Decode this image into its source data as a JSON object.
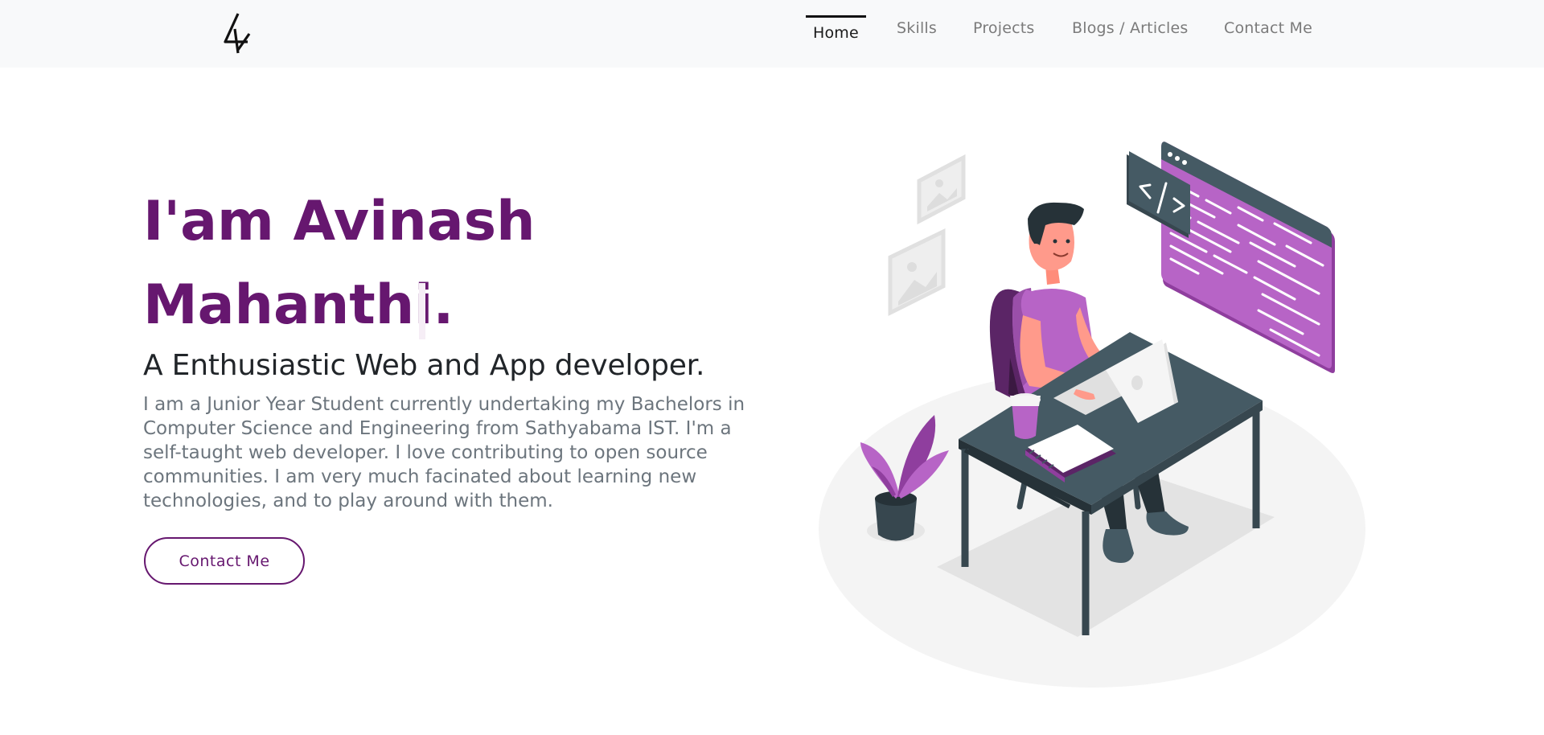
{
  "colors": {
    "accent": "#66176f",
    "illustration_purple": "#b764c6",
    "desk_dark": "#455a64",
    "nav_bg": "#f8f9fa"
  },
  "nav": {
    "logo_icon": "logo-mark-icon",
    "items": [
      {
        "label": "Home",
        "active": true
      },
      {
        "label": "Skills",
        "active": false
      },
      {
        "label": "Projects",
        "active": false
      },
      {
        "label": "Blogs / Articles",
        "active": false
      },
      {
        "label": "Contact Me",
        "active": false
      }
    ]
  },
  "hero": {
    "title_line1": "I'am Avinash",
    "title_line2": "Mahanthi.",
    "subtitle": "A Enthusiastic Web and App developer.",
    "description": "I am a Junior Year Student currently undertaking my Bachelors in Computer Science and Engineering from Sathyabama IST. I'm a self-taught web developer. I love contributing to open source communities. I am very much facinated about learning new technologies, and to play around with them.",
    "cta_label": "Contact Me"
  },
  "illustration": {
    "icon": "developer-at-desk-illustration",
    "code_icon_glyph": "</>"
  }
}
